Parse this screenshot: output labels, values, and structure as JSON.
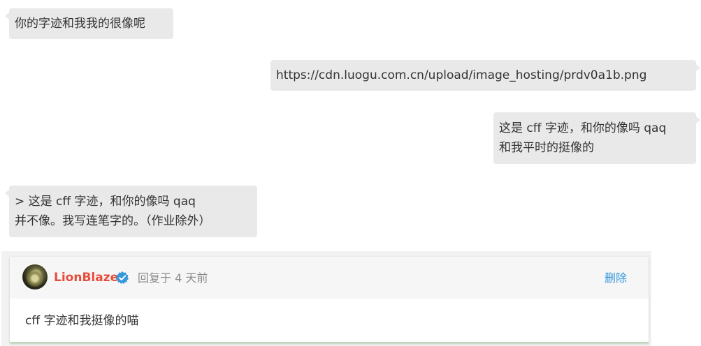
{
  "messages": [
    {
      "text": "你的字迹和我我的很像呢"
    },
    {
      "text": "https://cdn.luogu.com.cn/upload/image_hosting/prdv0a1b.png"
    },
    {
      "text": "这是 cff 字迹，和你的像吗 qaq\n和我平时的挺像的"
    },
    {
      "text": "> 这是 cff 字迹，和你的像吗 qaq\n并不像。我写连笔字的。（作业除外）"
    }
  ],
  "reply": {
    "username": "LionBlaze",
    "meta": "回复于 4 天前",
    "delete_label": "删除",
    "body": "cff 字迹和我挺像的喵"
  },
  "colors": {
    "bubble_bg": "#e9e9e9",
    "username": "#e74c3c",
    "verify_badge": "#3498db",
    "delete_link": "#3498db",
    "meta_text": "#8a8a8a"
  },
  "icons": {
    "verify": "verified-badge-icon",
    "avatar": "user-avatar"
  }
}
